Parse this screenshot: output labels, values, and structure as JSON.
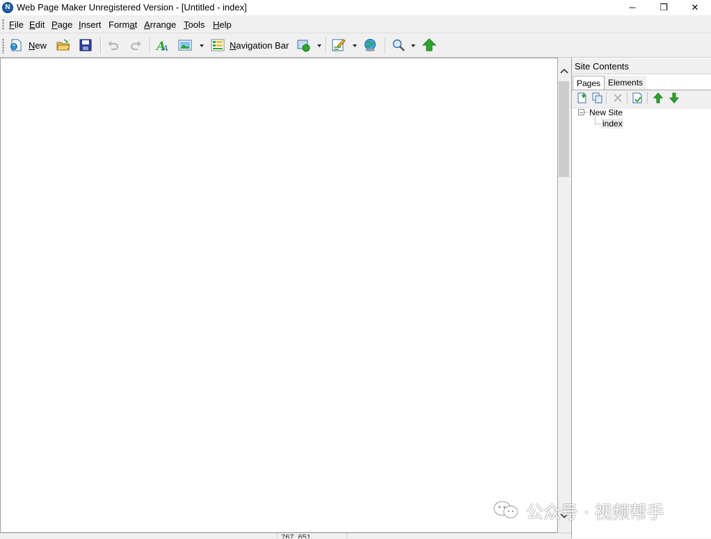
{
  "window": {
    "title": "Web Page Maker Unregistered Version - [Untitled - index]",
    "app_icon": "web-page-maker-logo",
    "controls": {
      "minimize": "─",
      "restore": "❐",
      "close": "✕"
    }
  },
  "menubar": {
    "items": [
      {
        "key": "F",
        "rest": "ile"
      },
      {
        "key": "E",
        "rest": "dit"
      },
      {
        "key": "P",
        "rest": "age"
      },
      {
        "key": "I",
        "rest": "nsert"
      },
      {
        "pre": "Form",
        "key": "a",
        "rest": "t"
      },
      {
        "key": "A",
        "rest": "rrange"
      },
      {
        "key": "T",
        "rest": "ools"
      },
      {
        "key": "H",
        "rest": "elp"
      }
    ]
  },
  "toolbar": {
    "new_key": "N",
    "new_rest": "ew",
    "navbar_key": "N",
    "navbar_rest": "avigation Bar",
    "icons": [
      "new-page-icon",
      "open-folder-icon",
      "save-disk-icon",
      "undo-icon",
      "redo-icon",
      "text-icon",
      "image-icon",
      "navigation-bar-icon",
      "shape-icon",
      "form-edit-icon",
      "preview-globe-icon",
      "zoom-icon",
      "publish-icon"
    ]
  },
  "site_panel": {
    "title": "Site Contents",
    "tabs": [
      "Pages",
      "Elements"
    ],
    "active_tab": "Pages",
    "tree": {
      "root": "New Site",
      "root_toggle": "−",
      "children": [
        "index"
      ]
    }
  },
  "statusbar": {
    "coords": "767, 651"
  },
  "watermark": {
    "text": "公众号 · 视频帮手"
  },
  "colors": {
    "chrome": "#f0f0f0",
    "canvas": "#ffffff",
    "accent_green": "#2ea52e",
    "accent_blue": "#1e5fa8"
  }
}
